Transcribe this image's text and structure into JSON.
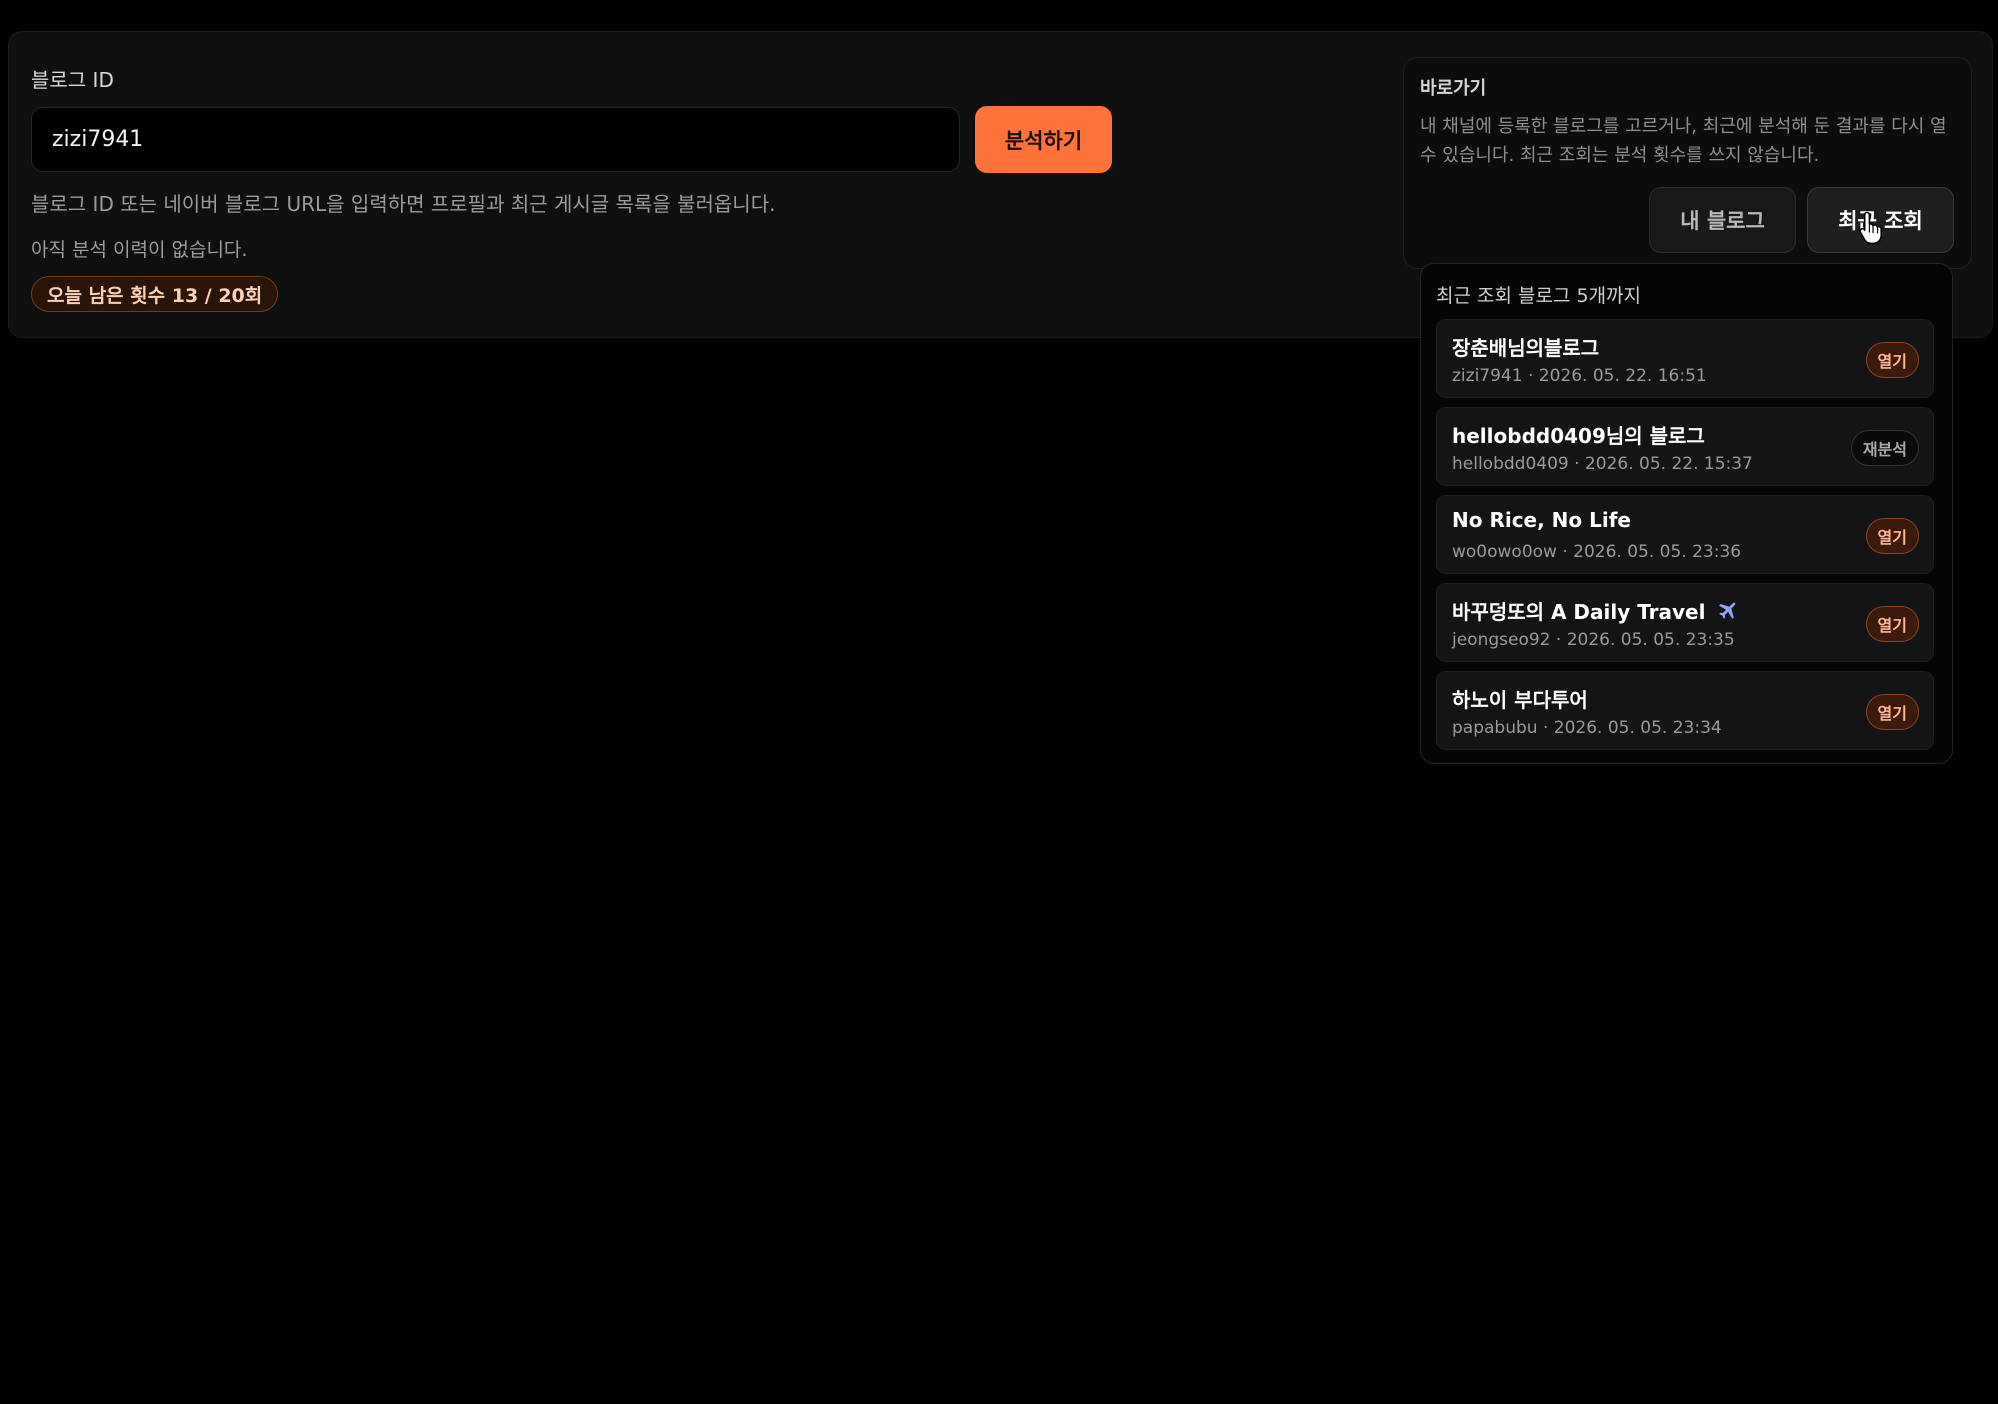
{
  "search": {
    "label": "블로그 ID",
    "value": "zizi7941",
    "analyze_button": "분석하기",
    "help_text": "블로그 ID 또는 네이버 블로그 URL을 입력하면 프로필과 최근 게시글 목록을 불러옵니다.",
    "history_empty": "아직 분석 이력이 없습니다.",
    "quota_badge": "오늘 남은 횟수 13 / 20회"
  },
  "shortcut": {
    "title": "바로가기",
    "description": "내 채널에 등록한 블로그를 고르거나, 최근에 분석해 둔 결과를 다시 열 수 있습니다. 최근 조회는 분석 횟수를 쓰지 않습니다.",
    "tabs": [
      "내 블로그",
      "최근 조회"
    ],
    "active_tab": "최근 조회"
  },
  "recent": {
    "title": "최근 조회 블로그 5개까지",
    "items": [
      {
        "name": "장춘배님의블로그",
        "id": "zizi7941",
        "date": "2026. 05. 22. 16:51",
        "action": "열기",
        "meta": "zizi7941 · 2026. 05. 22. 16:51"
      },
      {
        "name": "hellobdd0409님의 블로그",
        "id": "hellobdd0409",
        "date": "2026. 05. 22. 15:37",
        "action": "재분석",
        "meta": "hellobdd0409 · 2026. 05. 22. 15:37"
      },
      {
        "name": "No Rice, No Life",
        "id": "wo0owo0ow",
        "date": "2026. 05. 05. 23:36",
        "action": "열기",
        "meta": "wo0owo0ow · 2026. 05. 05. 23:36"
      },
      {
        "name": "바꾸덩또의 A Daily Travel",
        "id": "jeongseo92",
        "date": "2026. 05. 05. 23:35",
        "action": "열기",
        "meta": "jeongseo92 · 2026. 05. 05. 23:35",
        "icon": "airplane-icon"
      },
      {
        "name": "하노이 부다투어",
        "id": "papabubu",
        "date": "2026. 05. 05. 23:34",
        "action": "열기",
        "meta": "papabubu · 2026. 05. 05. 23:34"
      }
    ]
  },
  "colors": {
    "accent": "#ff7338",
    "background": "#000000",
    "panel": "#0f0f10"
  }
}
